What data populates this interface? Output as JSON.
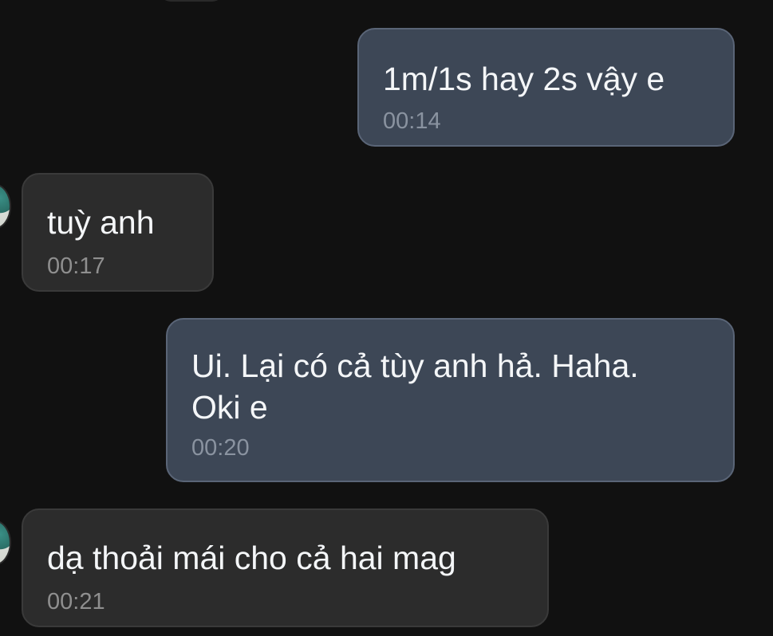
{
  "conversation": {
    "messages": [
      {
        "direction": "outgoing",
        "text": "1m/1s hay 2s vậy e",
        "time": "00:14"
      },
      {
        "direction": "incoming",
        "text": "tuỳ anh",
        "time": "00:17"
      },
      {
        "direction": "outgoing",
        "text_line1": "Ui. Lại có cả tùy anh hả. Haha.",
        "text_line2": "Oki e",
        "time": "00:20"
      },
      {
        "direction": "incoming",
        "text": "dạ thoải mái cho cả hai mag",
        "time": "00:21"
      }
    ]
  },
  "colors": {
    "background": "#111111",
    "outgoing_bubble": "#3d4756",
    "incoming_bubble": "#2c2c2c",
    "timestamp": "#8a93a0"
  }
}
